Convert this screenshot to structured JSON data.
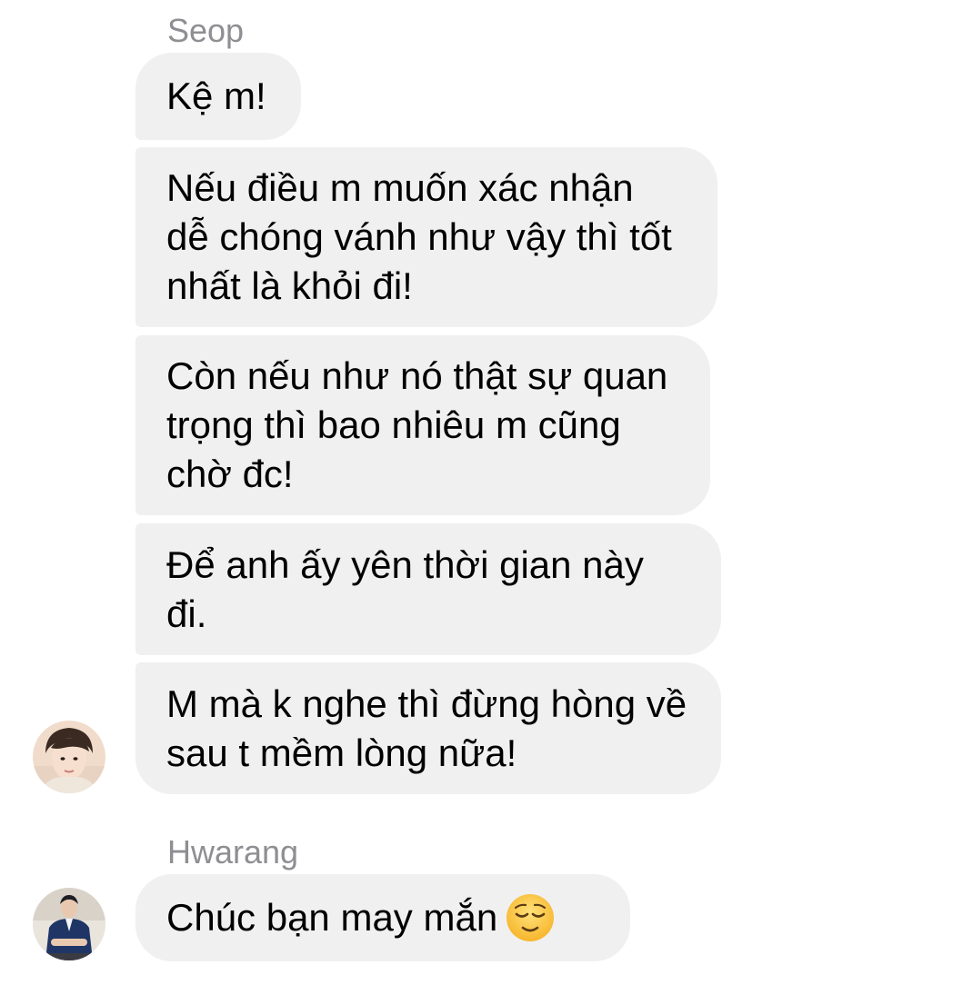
{
  "thread": {
    "groups": [
      {
        "sender": "Seop",
        "messages": [
          "Kệ m!",
          "Nếu điều m muốn xác nhận dễ chóng vánh như vậy thì tốt nhất là khỏi đi!",
          "Còn nếu như nó thật sự quan trọng thì bao nhiêu m cũng chờ đc!",
          "Để anh ấy yên thời gian này đi.",
          "M mà k nghe thì đừng hòng về sau t mềm lòng nữa!"
        ]
      },
      {
        "sender": "Hwarang",
        "messages": [
          "Chúc bạn may mắn"
        ],
        "emoji": "relieved-face-emoji"
      }
    ]
  },
  "colors": {
    "bubble": "#f0f0f0",
    "sender_name": "#8e8e93",
    "emoji_face": "#ffcc33"
  }
}
